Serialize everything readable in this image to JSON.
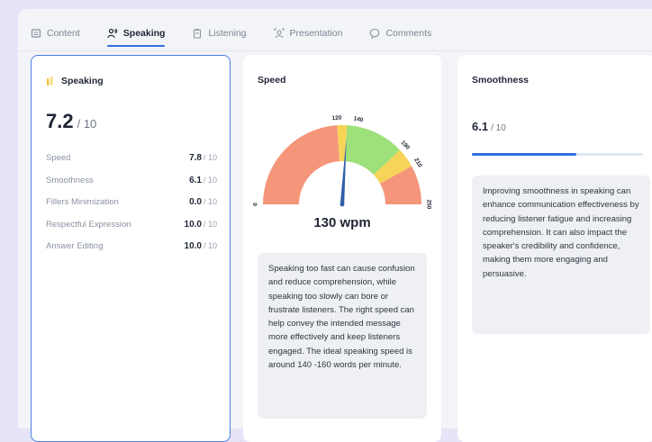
{
  "tabs": [
    {
      "label": "Content",
      "icon": "list-icon"
    },
    {
      "label": "Speaking",
      "icon": "speaker-person-icon"
    },
    {
      "label": "Listening",
      "icon": "clipboard-icon"
    },
    {
      "label": "Presentation",
      "icon": "presentation-icon"
    },
    {
      "label": "Comments",
      "icon": "comment-icon"
    }
  ],
  "speaking_card": {
    "title": "Speaking",
    "score": "7.2",
    "score_of": "/ 10",
    "metrics": [
      {
        "label": "Speed",
        "value": "7.8",
        "of": "/ 10"
      },
      {
        "label": "Smoothness",
        "value": "6.1",
        "of": "/ 10"
      },
      {
        "label": "Fillers Minimization",
        "value": "0.0",
        "of": "/ 10"
      },
      {
        "label": "Respectful Expression",
        "value": "10.0",
        "of": "/ 10"
      },
      {
        "label": "Answer Editing",
        "value": "10.0",
        "of": "/ 10"
      }
    ]
  },
  "speed_card": {
    "title": "Speed",
    "value_label": "130 wpm",
    "note": "Speaking too fast can cause confusion and reduce comprehension, while speaking too slowly can bore or frustrate listeners. The right speed can help convey the intended message more effectively and keep listeners engaged. The ideal speaking speed is around 140 -160 words per minute.",
    "gauge": {
      "min": 0,
      "max": 250,
      "value": 130,
      "ticks": [
        "0",
        "120",
        "140",
        "190",
        "210",
        "250"
      ],
      "tick_values": [
        0,
        120,
        140,
        190,
        210,
        250
      ],
      "bands": [
        {
          "from": 0,
          "to": 120,
          "color": "#f5957a"
        },
        {
          "from": 120,
          "to": 130,
          "color": "#f7d458"
        },
        {
          "from": 130,
          "to": 190,
          "color": "#9ee07a"
        },
        {
          "from": 190,
          "to": 210,
          "color": "#f7d458"
        },
        {
          "from": 210,
          "to": 250,
          "color": "#f5957a"
        }
      ],
      "needle_color": "#2f5fa8"
    }
  },
  "smoothness_card": {
    "title": "Smoothness",
    "score": "6.1",
    "score_of": "/ 10",
    "progress": 0.61,
    "note": "Improving smoothness in speaking can enhance communication effectiveness by reducing listener fatigue and increasing comprehension. It can also impact the speaker's credibility and confidence, making them more engaging and persuasive."
  },
  "colors": {
    "accent": "#2f6fe0",
    "selected_border": "#4a7fe0",
    "speaking_icon": "#f2c23a"
  }
}
